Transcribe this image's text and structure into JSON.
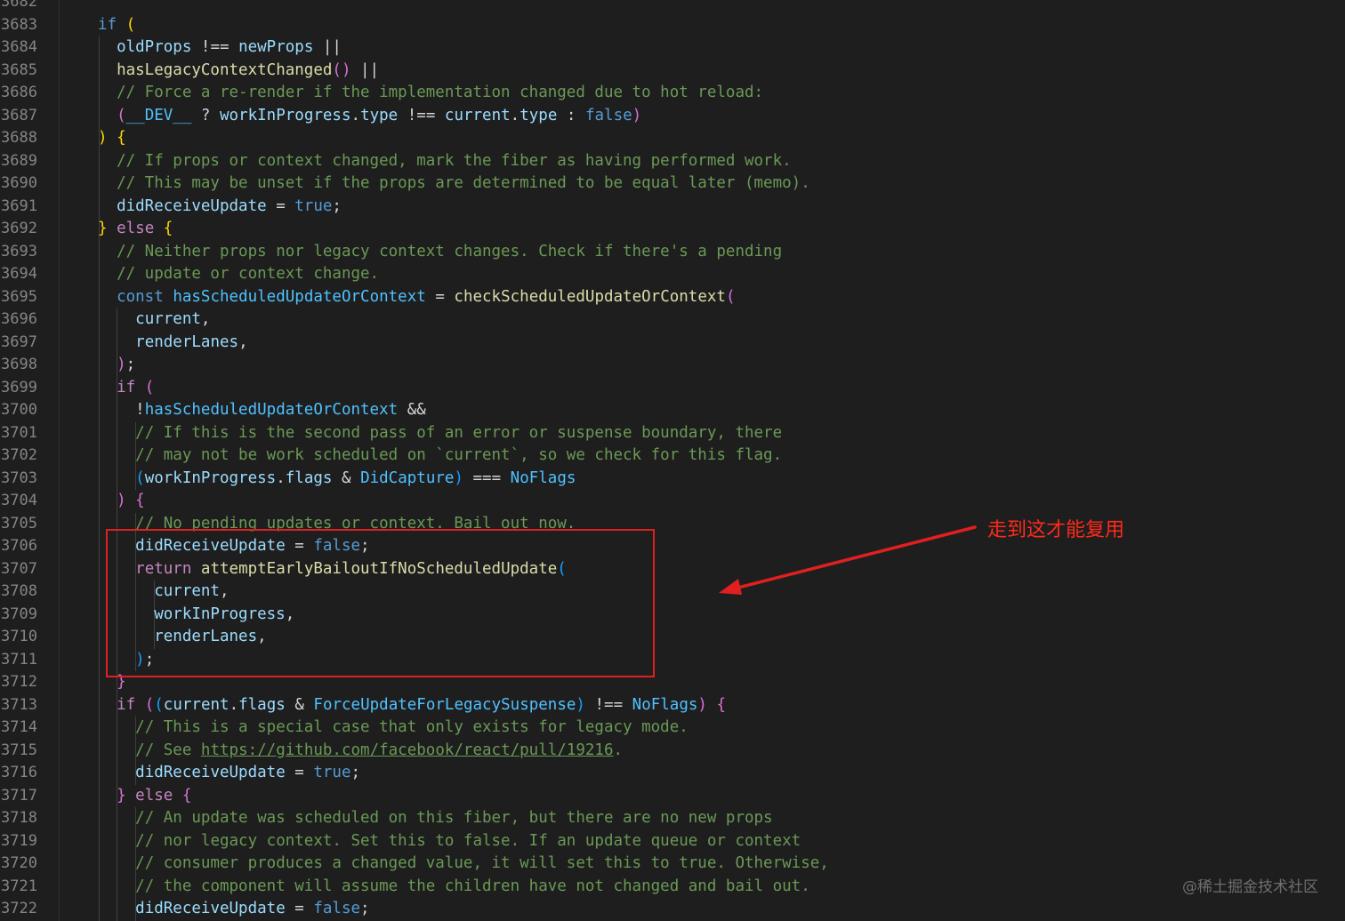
{
  "editor": {
    "line_numbers": [
      "3682",
      "3683",
      "3684",
      "3685",
      "3686",
      "3687",
      "3688",
      "3689",
      "3690",
      "3691",
      "3692",
      "3693",
      "3694",
      "3695",
      "3696",
      "3697",
      "3698",
      "3699",
      "3700",
      "3701",
      "3702",
      "3703",
      "3704",
      "3705",
      "3706",
      "3707",
      "3708",
      "3709",
      "3710",
      "3711",
      "3712",
      "3713",
      "3714",
      "3715",
      "3716",
      "3717",
      "3718",
      "3719",
      "3720",
      "3721",
      "3722"
    ],
    "lines": [
      [],
      [
        [
          "kw",
          "if"
        ],
        [
          "op",
          " "
        ],
        [
          "p1",
          "("
        ]
      ],
      [
        [
          "op",
          "  "
        ],
        [
          "id",
          "oldProps"
        ],
        [
          "op",
          " !== "
        ],
        [
          "id",
          "newProps"
        ],
        [
          "op",
          " ||"
        ]
      ],
      [
        [
          "op",
          "  "
        ],
        [
          "fn",
          "hasLegacyContextChanged"
        ],
        [
          "p2",
          "()"
        ],
        [
          "op",
          " ||"
        ]
      ],
      [
        [
          "op",
          "  "
        ],
        [
          "cm",
          "// Force a re-render if the implementation changed due to hot reload:"
        ]
      ],
      [
        [
          "op",
          "  "
        ],
        [
          "p2",
          "("
        ],
        [
          "const",
          "__DEV__"
        ],
        [
          "op",
          " ? "
        ],
        [
          "id",
          "workInProgress"
        ],
        [
          "op",
          "."
        ],
        [
          "id",
          "type"
        ],
        [
          "op",
          " !== "
        ],
        [
          "id",
          "current"
        ],
        [
          "op",
          "."
        ],
        [
          "id",
          "type"
        ],
        [
          "op",
          " : "
        ],
        [
          "bool",
          "false"
        ],
        [
          "p2",
          ")"
        ]
      ],
      [
        [
          "p1",
          ")"
        ],
        [
          "op",
          " "
        ],
        [
          "p1",
          "{"
        ]
      ],
      [
        [
          "op",
          "  "
        ],
        [
          "cm",
          "// If props or context changed, mark the fiber as having performed work."
        ]
      ],
      [
        [
          "op",
          "  "
        ],
        [
          "cm",
          "// This may be unset if the props are determined to be equal later (memo)."
        ]
      ],
      [
        [
          "op",
          "  "
        ],
        [
          "id",
          "didReceiveUpdate"
        ],
        [
          "op",
          " = "
        ],
        [
          "bool",
          "true"
        ],
        [
          "op",
          ";"
        ]
      ],
      [
        [
          "p1",
          "}"
        ],
        [
          "op",
          " "
        ],
        [
          "ctrl",
          "else"
        ],
        [
          "op",
          " "
        ],
        [
          "p1",
          "{"
        ]
      ],
      [
        [
          "op",
          "  "
        ],
        [
          "cm",
          "// Neither props nor legacy context changes. Check if there's a pending"
        ]
      ],
      [
        [
          "op",
          "  "
        ],
        [
          "cm",
          "// update or context change."
        ]
      ],
      [
        [
          "op",
          "  "
        ],
        [
          "kw",
          "const"
        ],
        [
          "op",
          " "
        ],
        [
          "const",
          "hasScheduledUpdateOrContext"
        ],
        [
          "op",
          " = "
        ],
        [
          "fn",
          "checkScheduledUpdateOrContext"
        ],
        [
          "p2",
          "("
        ]
      ],
      [
        [
          "op",
          "    "
        ],
        [
          "id",
          "current"
        ],
        [
          "op",
          ","
        ]
      ],
      [
        [
          "op",
          "    "
        ],
        [
          "id",
          "renderLanes"
        ],
        [
          "op",
          ","
        ]
      ],
      [
        [
          "op",
          "  "
        ],
        [
          "p2",
          ")"
        ],
        [
          "op",
          ";"
        ]
      ],
      [
        [
          "op",
          "  "
        ],
        [
          "ctrl",
          "if"
        ],
        [
          "op",
          " "
        ],
        [
          "p2",
          "("
        ]
      ],
      [
        [
          "op",
          "    !"
        ],
        [
          "const",
          "hasScheduledUpdateOrContext"
        ],
        [
          "op",
          " &&"
        ]
      ],
      [
        [
          "op",
          "    "
        ],
        [
          "cm",
          "// If this is the second pass of an error or suspense boundary, there"
        ]
      ],
      [
        [
          "op",
          "    "
        ],
        [
          "cm",
          "// may not be work scheduled on `current`, so we check for this flag."
        ]
      ],
      [
        [
          "op",
          "    "
        ],
        [
          "p3",
          "("
        ],
        [
          "id",
          "workInProgress"
        ],
        [
          "op",
          "."
        ],
        [
          "id",
          "flags"
        ],
        [
          "op",
          " & "
        ],
        [
          "const",
          "DidCapture"
        ],
        [
          "p3",
          ")"
        ],
        [
          "op",
          " === "
        ],
        [
          "const",
          "NoFlags"
        ]
      ],
      [
        [
          "op",
          "  "
        ],
        [
          "p2",
          ")"
        ],
        [
          "op",
          " "
        ],
        [
          "p2",
          "{"
        ]
      ],
      [
        [
          "op",
          "    "
        ],
        [
          "cm",
          "// No pending updates or context. Bail out now."
        ]
      ],
      [
        [
          "op",
          "    "
        ],
        [
          "id",
          "didReceiveUpdate"
        ],
        [
          "op",
          " = "
        ],
        [
          "bool",
          "false"
        ],
        [
          "op",
          ";"
        ]
      ],
      [
        [
          "op",
          "    "
        ],
        [
          "ctrl",
          "return"
        ],
        [
          "op",
          " "
        ],
        [
          "fn",
          "attemptEarlyBailoutIfNoScheduledUpdate"
        ],
        [
          "p3",
          "("
        ]
      ],
      [
        [
          "op",
          "      "
        ],
        [
          "id",
          "current"
        ],
        [
          "op",
          ","
        ]
      ],
      [
        [
          "op",
          "      "
        ],
        [
          "id",
          "workInProgress"
        ],
        [
          "op",
          ","
        ]
      ],
      [
        [
          "op",
          "      "
        ],
        [
          "id",
          "renderLanes"
        ],
        [
          "op",
          ","
        ]
      ],
      [
        [
          "op",
          "    "
        ],
        [
          "p3",
          ")"
        ],
        [
          "op",
          ";"
        ]
      ],
      [
        [
          "op",
          "  "
        ],
        [
          "p2",
          "}"
        ]
      ],
      [
        [
          "op",
          "  "
        ],
        [
          "ctrl",
          "if"
        ],
        [
          "op",
          " "
        ],
        [
          "p2",
          "("
        ],
        [
          "p3",
          "("
        ],
        [
          "id",
          "current"
        ],
        [
          "op",
          "."
        ],
        [
          "id",
          "flags"
        ],
        [
          "op",
          " & "
        ],
        [
          "const",
          "ForceUpdateForLegacySuspense"
        ],
        [
          "p3",
          ")"
        ],
        [
          "op",
          " !== "
        ],
        [
          "const",
          "NoFlags"
        ],
        [
          "p2",
          ")"
        ],
        [
          "op",
          " "
        ],
        [
          "p2",
          "{"
        ]
      ],
      [
        [
          "op",
          "    "
        ],
        [
          "cm",
          "// This is a special case that only exists for legacy mode."
        ]
      ],
      [
        [
          "op",
          "    "
        ],
        [
          "cm",
          "// See "
        ],
        [
          "link",
          "https://github.com/facebook/react/pull/19216"
        ],
        [
          "cm",
          "."
        ]
      ],
      [
        [
          "op",
          "    "
        ],
        [
          "id",
          "didReceiveUpdate"
        ],
        [
          "op",
          " = "
        ],
        [
          "bool",
          "true"
        ],
        [
          "op",
          ";"
        ]
      ],
      [
        [
          "op",
          "  "
        ],
        [
          "p2",
          "}"
        ],
        [
          "op",
          " "
        ],
        [
          "ctrl",
          "else"
        ],
        [
          "op",
          " "
        ],
        [
          "p2",
          "{"
        ]
      ],
      [
        [
          "op",
          "    "
        ],
        [
          "cm",
          "// An update was scheduled on this fiber, but there are no new props"
        ]
      ],
      [
        [
          "op",
          "    "
        ],
        [
          "cm",
          "// nor legacy context. Set this to false. If an update queue or context"
        ]
      ],
      [
        [
          "op",
          "    "
        ],
        [
          "cm",
          "// consumer produces a changed value, it will set this to true. Otherwise,"
        ]
      ],
      [
        [
          "op",
          "    "
        ],
        [
          "cm",
          "// the component will assume the children have not changed and bail out."
        ]
      ],
      [
        [
          "op",
          "    "
        ],
        [
          "id",
          "didReceiveUpdate"
        ],
        [
          "op",
          " = "
        ],
        [
          "bool",
          "false"
        ],
        [
          "op",
          ";"
        ]
      ]
    ]
  },
  "annotation": {
    "text": "走到这才能复用",
    "color": "#ff2a1a"
  },
  "watermark": {
    "text": "@稀土掘金技术社区"
  },
  "colors": {
    "background": "#1e1e1e",
    "keyword": "#569cd6",
    "control": "#c586c0",
    "identifier": "#9cdcfe",
    "function": "#dcdcaa",
    "comment": "#6a9955",
    "constant": "#4fc1ff",
    "bracket1": "#ffd700",
    "bracket2": "#da70d6",
    "bracket3": "#179fff",
    "highlight_box": "#e02020"
  }
}
